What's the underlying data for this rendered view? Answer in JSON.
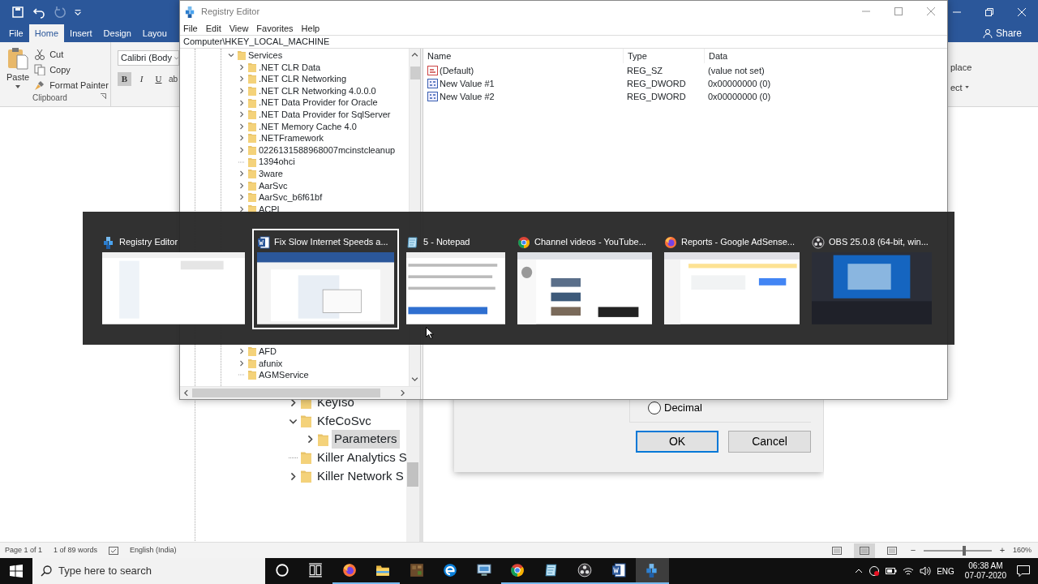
{
  "word": {
    "quick_access": [
      {
        "kind": "save",
        "disabled": false
      },
      {
        "kind": "undo",
        "disabled": false
      },
      {
        "kind": "redo",
        "disabled": true
      },
      {
        "kind": "customize",
        "disabled": false
      }
    ],
    "tabs": [
      {
        "label": "File",
        "selected": false
      },
      {
        "label": "Home",
        "selected": true
      },
      {
        "label": "Insert",
        "selected": false
      },
      {
        "label": "Design",
        "selected": false
      },
      {
        "label": "Layou",
        "selected": false
      }
    ],
    "share": "Share",
    "clipboard": {
      "paste": "Paste",
      "commands": [
        {
          "kind": "cut",
          "label": "Cut"
        },
        {
          "kind": "copy",
          "label": "Copy"
        },
        {
          "kind": "format-painter",
          "label": "Format Painter"
        }
      ],
      "group_label": "Clipboard"
    },
    "font": {
      "value": "Calibri (Body",
      "format_buttons": [
        {
          "kind": "bold",
          "label": "B",
          "selected": true
        },
        {
          "kind": "italic",
          "label": "I",
          "selected": false
        },
        {
          "kind": "underline",
          "label": "U",
          "selected": false
        }
      ],
      "fragment": "ab"
    },
    "editing_fragments": [
      {
        "label": "place",
        "dropdown": false
      },
      {
        "label": "ect",
        "dropdown": true
      }
    ],
    "document_image": {
      "tree": [
        {
          "kind": "branch",
          "label": "KeyIso",
          "expanded": false,
          "selected": false
        },
        {
          "kind": "branch",
          "label": "KfeCoSvc",
          "expanded": true,
          "selected": false,
          "children": [
            {
              "kind": "branch",
              "label": "Parameters",
              "expanded": false,
              "selected": true
            }
          ]
        },
        {
          "kind": "leaf",
          "label": "Killer Analytics S",
          "selected": false
        },
        {
          "kind": "branch",
          "label": "Killer Network S",
          "expanded": false,
          "selected": false
        }
      ],
      "radio": {
        "label": "Decimal",
        "checked": false
      },
      "buttons": [
        {
          "label": "OK",
          "default": true
        },
        {
          "label": "Cancel",
          "default": false
        }
      ]
    },
    "status_bar": {
      "page": "Page 1 of 1",
      "words": "1 of 89 words",
      "language": "English (India)",
      "zoom_out": "−",
      "zoom_in": "+",
      "zoom": "160%",
      "zoom_slider": {
        "level": 0.6
      }
    }
  },
  "regedit": {
    "title": "Registry Editor",
    "menu": [
      "File",
      "Edit",
      "View",
      "Favorites",
      "Help"
    ],
    "address": "Computer\\HKEY_LOCAL_MACHINE",
    "tree": [
      {
        "kind": "branch",
        "label": "Services",
        "expanded": true,
        "children": [
          {
            "kind": "branch",
            "label": ".NET CLR Data",
            "expanded": false
          },
          {
            "kind": "branch",
            "label": ".NET CLR Networking",
            "expanded": false
          },
          {
            "kind": "branch",
            "label": ".NET CLR Networking 4.0.0.0",
            "expanded": false
          },
          {
            "kind": "branch",
            "label": ".NET Data Provider for Oracle",
            "expanded": false
          },
          {
            "kind": "branch",
            "label": ".NET Data Provider for SqlServer",
            "expanded": false
          },
          {
            "kind": "branch",
            "label": ".NET Memory Cache 4.0",
            "expanded": false
          },
          {
            "kind": "branch",
            "label": ".NETFramework",
            "expanded": false
          },
          {
            "kind": "branch",
            "label": "0226131588968007mcinstcleanup",
            "expanded": false
          },
          {
            "kind": "leaf",
            "label": "1394ohci"
          },
          {
            "kind": "branch",
            "label": "3ware",
            "expanded": false
          },
          {
            "kind": "branch",
            "label": "AarSvc",
            "expanded": false
          },
          {
            "kind": "branch",
            "label": "AarSvc_b6f61bf",
            "expanded": false
          },
          {
            "kind": "branch",
            "label": "ACPI",
            "expanded": false
          }
        ]
      }
    ],
    "tree_below_switcher": [
      {
        "kind": "branch",
        "label": "AFD",
        "expanded": false
      },
      {
        "kind": "branch",
        "label": "afunix",
        "expanded": false
      },
      {
        "kind": "leaf",
        "label": "AGMService"
      }
    ],
    "list": {
      "columns": [
        "Name",
        "Type",
        "Data"
      ],
      "rows": [
        {
          "kind": "string",
          "name": "(Default)",
          "type": "REG_SZ",
          "data": "(value not set)"
        },
        {
          "kind": "binary",
          "name": "New Value #1",
          "type": "REG_DWORD",
          "data": "0x00000000 (0)"
        },
        {
          "kind": "binary",
          "name": "New Value #2",
          "type": "REG_DWORD",
          "data": "0x00000000 (0)"
        }
      ]
    }
  },
  "task_switcher": {
    "items": [
      {
        "kind": "regedit",
        "title": "Registry Editor",
        "selected": false
      },
      {
        "kind": "word",
        "title": "Fix Slow Internet Speeds a...",
        "selected": true
      },
      {
        "kind": "notepad",
        "title": "5 - Notepad",
        "selected": false
      },
      {
        "kind": "chrome",
        "title": "Channel videos - YouTube...",
        "selected": false
      },
      {
        "kind": "firefox",
        "title": "Reports - Google AdSense...",
        "selected": false
      },
      {
        "kind": "obs",
        "title": "OBS 25.0.8 (64-bit, win...",
        "selected": false
      }
    ]
  },
  "taskbar": {
    "search_placeholder": "Type here to search",
    "apps": [
      {
        "kind": "cortana",
        "running": false,
        "selected": false
      },
      {
        "kind": "taskview",
        "running": false,
        "selected": false
      },
      {
        "kind": "firefox",
        "running": true,
        "selected": false
      },
      {
        "kind": "explorer",
        "running": true,
        "selected": false
      },
      {
        "kind": "blocks",
        "running": false,
        "selected": false
      },
      {
        "kind": "edge",
        "running": false,
        "selected": false
      },
      {
        "kind": "monitor",
        "running": false,
        "selected": false
      },
      {
        "kind": "chrome",
        "running": true,
        "selected": false
      },
      {
        "kind": "notepad",
        "running": true,
        "selected": false
      },
      {
        "kind": "obs",
        "running": true,
        "selected": false
      },
      {
        "kind": "word",
        "running": true,
        "selected": false
      },
      {
        "kind": "regedit",
        "running": true,
        "selected": true
      }
    ],
    "language": "ENG",
    "time": "06:38 AM",
    "date": "07-07-2020"
  }
}
